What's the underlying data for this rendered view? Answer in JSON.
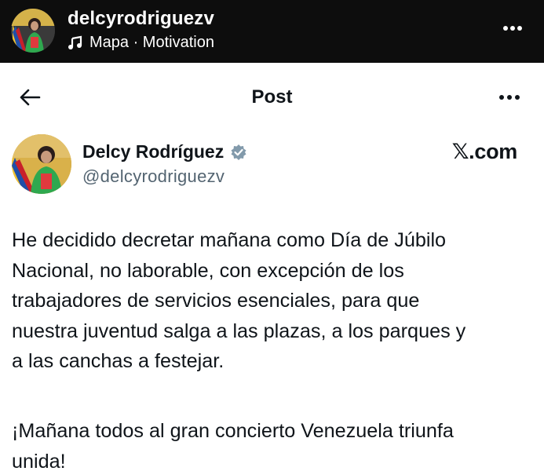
{
  "story": {
    "username": "delcyrodriguezv",
    "music_line": "Mapa · Motivation",
    "music_icon": "music-note-icon",
    "more_icon": "more-horizontal-icon"
  },
  "post_header": {
    "title": "Post",
    "back_icon": "arrow-left-icon",
    "more_icon": "more-horizontal-icon"
  },
  "author": {
    "name": "Delcy Rodríguez",
    "handle": "@delcyrodriguezv",
    "verified_icon": "verified-badge-icon",
    "source": "𝕏.com"
  },
  "post": {
    "text": "He decidido decretar mañana como Día de Júbilo\nNacional, no laborable, con excepción de los\ntrabajadores de servicios esenciales, para que\nnuestra juventud salga a las plazas, a los parques y\na las canchas a festejar.",
    "text_2": "¡Mañana todos al gran concierto Venezuela triunfa\nunida!"
  },
  "colors": {
    "story_bar_bg": "#0d0d0d",
    "text_primary": "#0f1419",
    "text_secondary": "#536471",
    "verified": "#829aab"
  }
}
